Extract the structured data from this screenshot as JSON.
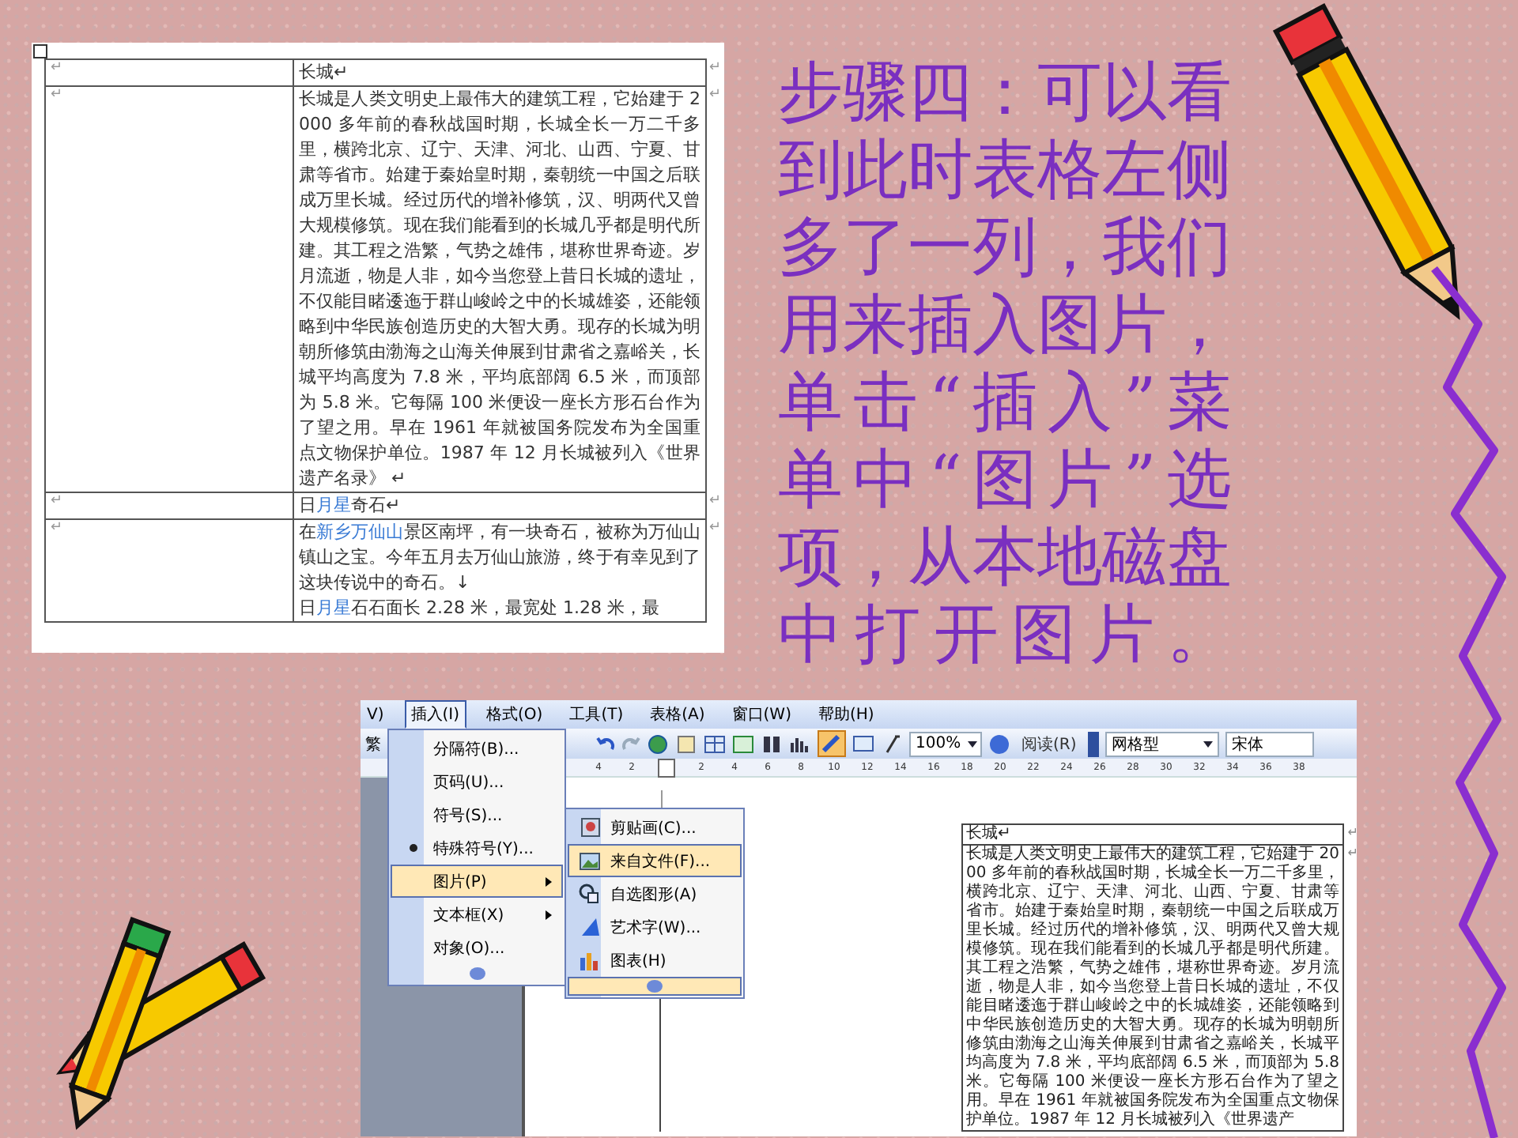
{
  "document_top": {
    "rows": [
      {
        "left": "↵",
        "end_mark": "↵",
        "paragraphs": [
          [
            {
              "text": "长城↵",
              "highlight": false
            }
          ]
        ]
      },
      {
        "left": "↵",
        "end_mark": "↵",
        "paragraphs": [
          [
            {
              "text": "长城是人类文明史上最伟大的建筑工程，它始建于 2000 多年前的春秋战国时期，长城全长一万二千多里，横跨北京、辽宁、天津、河北、山西、宁夏、甘肃等省市。始建于秦始皇时期，秦朝统一中国之后联成万里长城。经过历代的增补修筑，汉、明两代又曾大规模修筑。现在我们能看到的长城几乎都是明代所建。其工程之浩繁，气势之雄伟，堪称世界奇迹。岁月流逝，物是人非，如今当您登上昔日长城的遗址，不仅能目睹逶迤于群山峻岭之中的长城雄姿，还能领略到中华民族创造历史的大智大勇。现存的长城为明朝所修筑由渤海之山海关伸展到甘肃省之嘉峪关，长城平均高度为 7.8 米，平均底部阔 6.5 米，而顶部为 5.8 米。它每隔 100 米便设一座长方形石台作为了望之用。早在 1961 年就被国务院发布为全国重点文物保护单位。1987 年 12 月长城被列入《世界遗产名录》 ↵",
              "highlight": false
            }
          ]
        ]
      },
      {
        "left": "↵",
        "end_mark": "↵",
        "paragraphs": [
          [
            {
              "text": "日",
              "highlight": false
            },
            {
              "text": "月星",
              "highlight": true
            },
            {
              "text": "奇石↵",
              "highlight": false
            }
          ]
        ]
      },
      {
        "left": "↵",
        "end_mark": "↵",
        "paragraphs": [
          [
            {
              "text": "在",
              "highlight": false
            },
            {
              "text": "新乡万仙山",
              "highlight": true
            },
            {
              "text": "景区南坪，有一块奇石，被称为万仙山镇山之宝。今年五月去万仙山旅游，终于有幸见到了这块传说中的奇石。↓",
              "highlight": false
            }
          ],
          [
            {
              "text": "日",
              "highlight": false
            },
            {
              "text": "月星",
              "highlight": true
            },
            {
              "text": "石石面长 2.28 米，最宽处 1.28 米，最",
              "highlight": false
            }
          ]
        ]
      }
    ]
  },
  "step_text": "步骤四：可以看到此时表格左侧多了一列，我们用来插入图片，单击“插入”菜单中“图片”选项，从本地磁盘中打开图片。",
  "word_window": {
    "menu_bar": [
      {
        "label": "V)",
        "selected": false
      },
      {
        "label": "插入(I)",
        "selected": true
      },
      {
        "label": "格式(O)",
        "selected": false
      },
      {
        "label": "工具(T)",
        "selected": false
      },
      {
        "label": "表格(A)",
        "selected": false
      },
      {
        "label": "窗口(W)",
        "selected": false
      },
      {
        "label": "帮助(H)",
        "selected": false
      }
    ],
    "toolbar": {
      "first_button": "繁",
      "zoom": "100%",
      "read_button": "阅读(R)",
      "style": "网格型",
      "font": "宋体"
    },
    "ruler": {
      "left_labels": [
        "4",
        "2"
      ],
      "right_labels": [
        "2",
        "4",
        "6",
        "8",
        "10",
        "12",
        "14",
        "16",
        "18",
        "20",
        "22",
        "24",
        "26",
        "28",
        "30",
        "32",
        "34",
        "36",
        "38"
      ]
    },
    "insert_menu": {
      "items": [
        {
          "label": "分隔符(B)...",
          "kind": "plain",
          "selected": false
        },
        {
          "label": "页码(U)...",
          "kind": "plain",
          "selected": false
        },
        {
          "label": "符号(S)...",
          "kind": "plain",
          "selected": false
        },
        {
          "label": "特殊符号(Y)...",
          "kind": "bullet",
          "selected": false
        },
        {
          "label": "图片(P)",
          "kind": "submenu",
          "selected": true
        },
        {
          "label": "文本框(X)",
          "kind": "submenu",
          "selected": false
        },
        {
          "label": "对象(O)...",
          "kind": "plain",
          "selected": false
        }
      ],
      "more_selected": false
    },
    "picture_menu": {
      "items": [
        {
          "label": "剪贴画(C)...",
          "kind": "clipart",
          "selected": false
        },
        {
          "label": "来自文件(F)...",
          "kind": "file",
          "selected": true
        },
        {
          "label": "自选图形(A)",
          "kind": "shapes",
          "selected": false
        },
        {
          "label": "艺术字(W)...",
          "kind": "wordart",
          "selected": false
        },
        {
          "label": "图表(H)",
          "kind": "chart",
          "selected": false
        }
      ],
      "more_selected": true
    },
    "table": {
      "header": "长城↵",
      "header_end_mark": "↵",
      "body": "长城是人类文明史上最伟大的建筑工程，它始建于 2000 多年前的春秋战国时期，长城全长一万二千多里，横跨北京、辽宁、天津、河北、山西、宁夏、甘肃等省市。始建于秦始皇时期，秦朝统一中国之后联成万里长城。经过历代的增补修筑，汉、明两代又曾大规模修筑。现在我们能看到的长城几乎都是明代所建。其工程之浩繁，气势之雄伟，堪称世界奇迹。岁月流逝，物是人非，如今当您登上昔日长城的遗址，不仅能目睹逶迤于群山峻岭之中的长城雄姿，还能领略到中华民族创造历史的大智大勇。现存的长城为明朝所修筑由渤海之山海关伸展到甘肃省之嘉峪关，长城平均高度为 7.8 米，平均底部阔 6.5 米，而顶部为 5.8 米。它每隔 100 米便设一座长方形石台作为了望之用。早在 1961 年就被国务院发布为全国重点文物保护单位。1987 年 12 月长城被列入《世界遗产",
      "body_end_mark": "↵"
    }
  }
}
